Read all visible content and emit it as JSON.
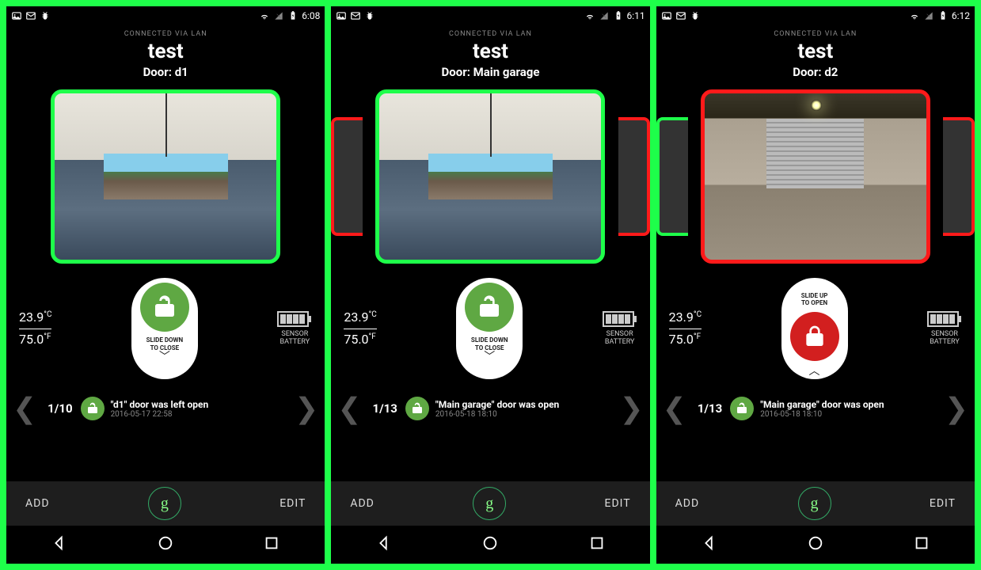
{
  "screens": [
    {
      "status_time": "6:08",
      "connected": "CONNECTED VIA LAN",
      "title": "test",
      "door_label": "Door: d1",
      "cam_border": "#1eff4a",
      "side_left_color": null,
      "side_right_color": null,
      "door_state": "open",
      "temp_c": "23.9",
      "temp_c_unit": "°C",
      "temp_f": "75.0",
      "temp_f_unit": "°F",
      "slider_state": "open",
      "slider_text_1": "SLIDE DOWN",
      "slider_text_2": "TO CLOSE",
      "battery_label_1": "SENSOR",
      "battery_label_2": "BATTERY",
      "counter": "1/10",
      "event_title": "\"d1\" door was left open",
      "event_date": "2016-05-17 22:58",
      "add": "ADD",
      "edit": "EDIT"
    },
    {
      "status_time": "6:11",
      "connected": "CONNECTED VIA LAN",
      "title": "test",
      "door_label": "Door: Main garage",
      "cam_border": "#1eff4a",
      "side_left_color": "#ff1a1a",
      "side_right_color": "#ff1a1a",
      "door_state": "open",
      "temp_c": "23.9",
      "temp_c_unit": "°C",
      "temp_f": "75.0",
      "temp_f_unit": "°F",
      "slider_state": "open",
      "slider_text_1": "SLIDE DOWN",
      "slider_text_2": "TO CLOSE",
      "battery_label_1": "SENSOR",
      "battery_label_2": "BATTERY",
      "counter": "1/13",
      "event_title": "\"Main garage\" door was open",
      "event_date": "2016-05-18 18:10",
      "add": "ADD",
      "edit": "EDIT"
    },
    {
      "status_time": "6:12",
      "connected": "CONNECTED VIA LAN",
      "title": "test",
      "door_label": "Door: d2",
      "cam_border": "#ff1a1a",
      "side_left_color": "#1eff4a",
      "side_right_color": "#ff1a1a",
      "door_state": "closed",
      "temp_c": "23.9",
      "temp_c_unit": "°C",
      "temp_f": "75.0",
      "temp_f_unit": "°F",
      "slider_state": "closed",
      "slider_text_1": "SLIDE UP",
      "slider_text_2": "TO OPEN",
      "battery_label_1": "SENSOR",
      "battery_label_2": "BATTERY",
      "counter": "1/13",
      "event_title": "\"Main garage\" door was open",
      "event_date": "2016-05-18 18:10",
      "add": "ADD",
      "edit": "EDIT"
    }
  ]
}
